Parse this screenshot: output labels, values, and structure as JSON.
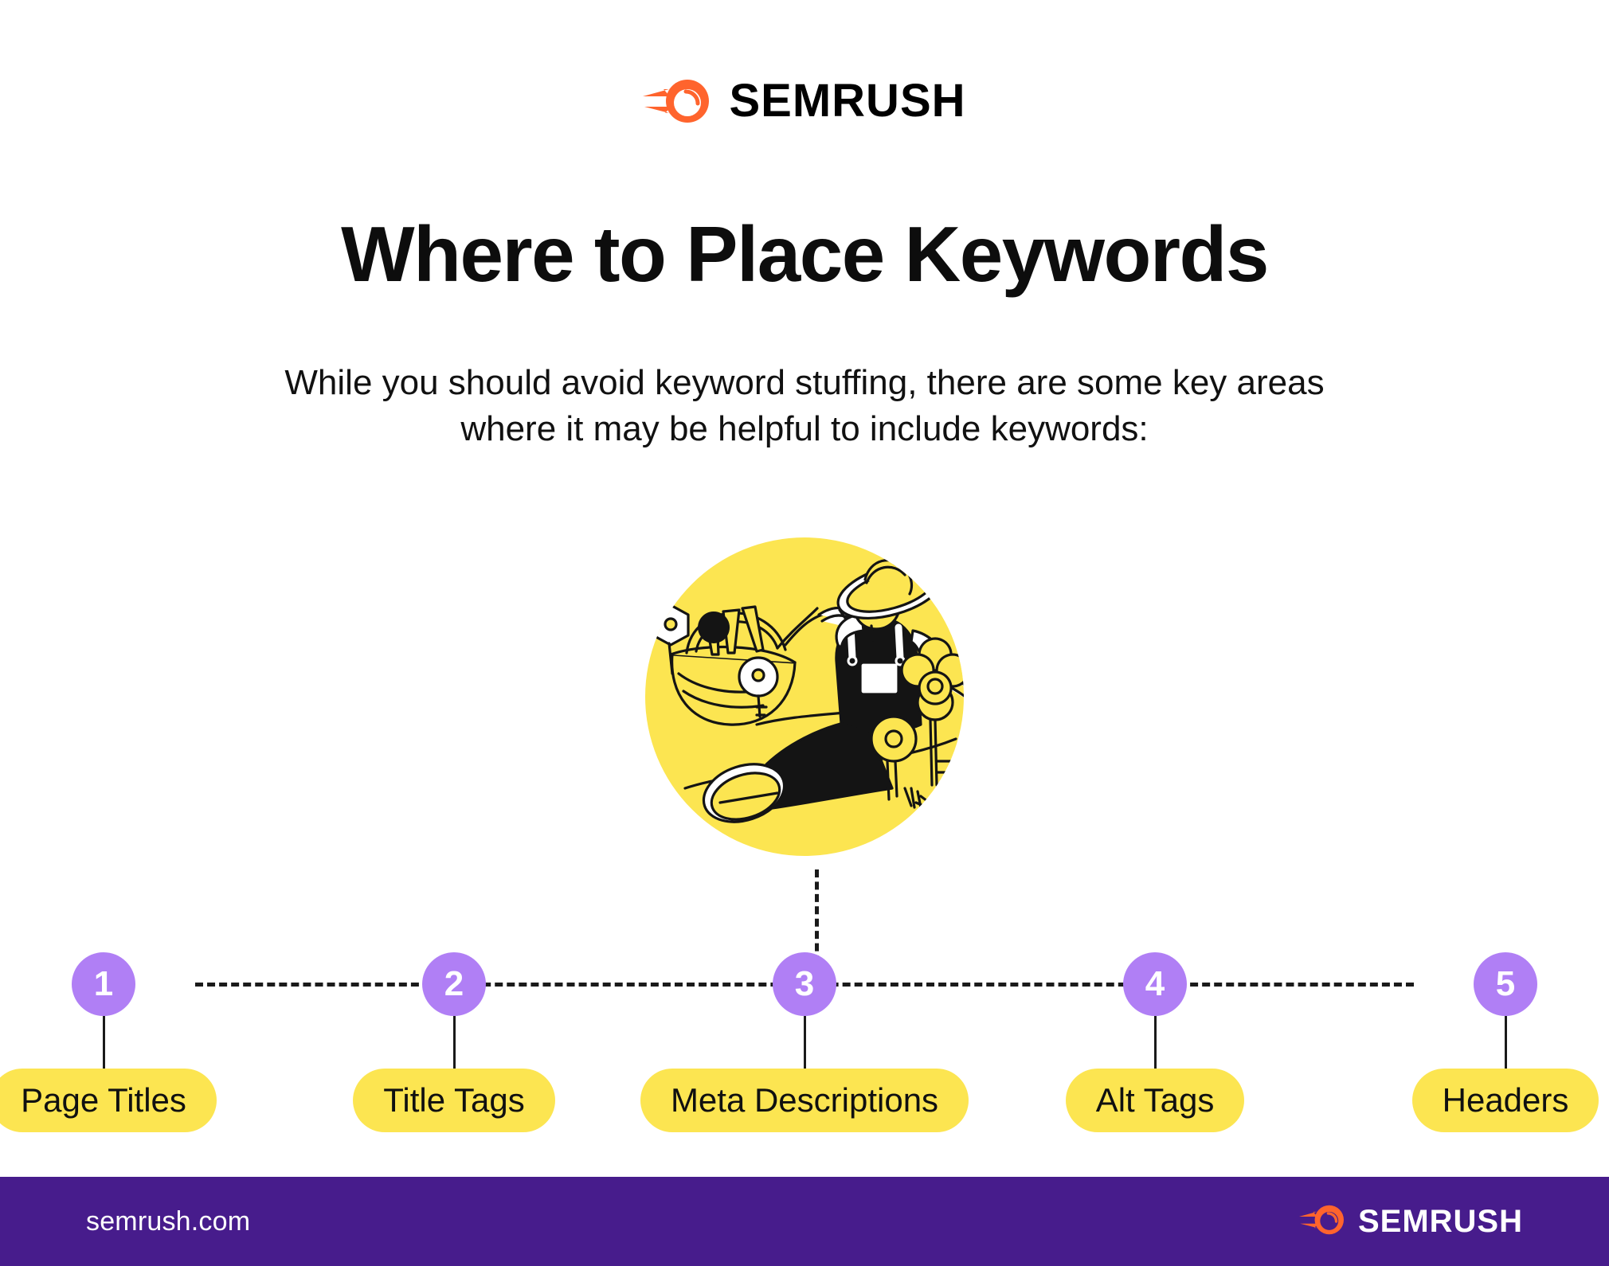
{
  "brand": {
    "name": "SEMRUSH",
    "logo_icon": "semrush-comet-icon",
    "accent_orange": "#FF642D",
    "accent_purple": "#471C8C",
    "accent_yellow": "#FCE551",
    "badge_purple": "#B07FF5"
  },
  "header": {
    "logo_word": "SEMRUSH"
  },
  "title": "Where to Place Keywords",
  "subtitle": "While you should avoid keyword stuffing, there are some key areas where it may be helpful to include keywords:",
  "illustration": {
    "name": "gardener-with-key-basket-illustration",
    "background_circle_color": "#FCE551",
    "description": "Person in straw hat and overalls carrying a basket of keys, with key-shaped flowers growing from the ground"
  },
  "steps": [
    {
      "number": "1",
      "label": "Page Titles"
    },
    {
      "number": "2",
      "label": "Title Tags"
    },
    {
      "number": "3",
      "label": "Meta Descriptions"
    },
    {
      "number": "4",
      "label": "Alt Tags"
    },
    {
      "number": "5",
      "label": "Headers"
    }
  ],
  "footer": {
    "url": "semrush.com",
    "logo_word": "SEMRUSH"
  }
}
